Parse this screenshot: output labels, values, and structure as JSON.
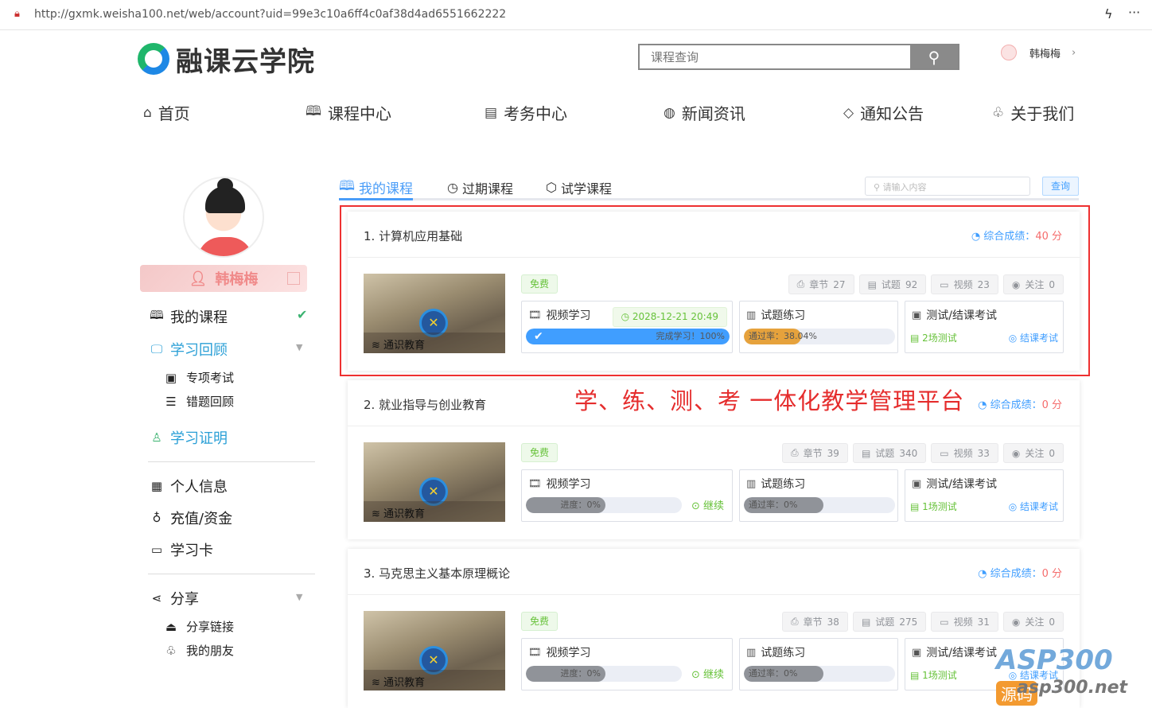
{
  "browser": {
    "url": "http://gxmk.weisha100.net/web/account?uid=99e3c10a6ff4c0af38d4ad6551662222"
  },
  "header": {
    "logo_text": "融课云学院",
    "search_placeholder": "课程查询",
    "user_name": "韩梅梅"
  },
  "nav": [
    {
      "label": "首页",
      "icon": "⌂"
    },
    {
      "label": "课程中心",
      "icon": "🕮"
    },
    {
      "label": "考务中心",
      "icon": "▤"
    },
    {
      "label": "新闻资讯",
      "icon": "◍"
    },
    {
      "label": "通知公告",
      "icon": "◇"
    },
    {
      "label": "关于我们",
      "icon": "♧"
    }
  ],
  "sidebar": {
    "name": "韩梅梅",
    "items": [
      {
        "label": "我的课程"
      },
      {
        "label": "学习回顾"
      },
      {
        "label": "专项考试"
      },
      {
        "label": "错题回顾"
      },
      {
        "label": "学习证明"
      },
      {
        "label": "个人信息"
      },
      {
        "label": "充值/资金"
      },
      {
        "label": "学习卡"
      },
      {
        "label": "分享"
      },
      {
        "label": "分享链接"
      },
      {
        "label": "我的朋友"
      }
    ]
  },
  "tabs": [
    {
      "label": "我的课程"
    },
    {
      "label": "过期课程"
    },
    {
      "label": "试学课程"
    }
  ],
  "tab_search": {
    "placeholder": "请输入内容",
    "button": "查询"
  },
  "slogan": "学、练、测、考 一体化教学管理平台",
  "watermark": {
    "brand": "ASP300",
    "tag": "源码",
    "domain": "asp300.net"
  },
  "labels": {
    "score": "综合成绩：",
    "free": "免费",
    "video": "视频学习",
    "practice": "试题练习",
    "exam": "测试/结课考试",
    "final": "结课考试",
    "continue": "继续",
    "thumb": "通识教育",
    "chapter": "章节",
    "questions": "试题",
    "videos": "视频",
    "follow": "关注"
  },
  "colors": {
    "accent": "#409eff",
    "success": "#67c23a",
    "danger": "#f56c6c",
    "warning": "#e6a23c",
    "highlight": "#ee3030"
  },
  "courses": [
    {
      "title": "1. 计算机应用基础",
      "score": "40 分",
      "chapters": "27",
      "questions": "92",
      "videos": "23",
      "follows": "0",
      "date": "2028-12-21 20:49",
      "video_text": "完成学习！100%",
      "video_pct": 100,
      "pass_text": "通过率：38.04%",
      "pass_pct": 38.04,
      "tests": "2场测试"
    },
    {
      "title": "2. 就业指导与创业教育",
      "score": "0 分",
      "chapters": "39",
      "questions": "340",
      "videos": "33",
      "follows": "0",
      "video_text": "进度：0%",
      "video_pct": 0,
      "pass_text": "通过率：0%",
      "pass_pct": 0,
      "tests": "1场测试"
    },
    {
      "title": "3. 马克思主义基本原理概论",
      "score": "0 分",
      "chapters": "38",
      "questions": "275",
      "videos": "31",
      "follows": "0",
      "video_text": "进度：0%",
      "video_pct": 0,
      "pass_text": "通过率：0%",
      "pass_pct": 0,
      "tests": "1场测试"
    }
  ]
}
